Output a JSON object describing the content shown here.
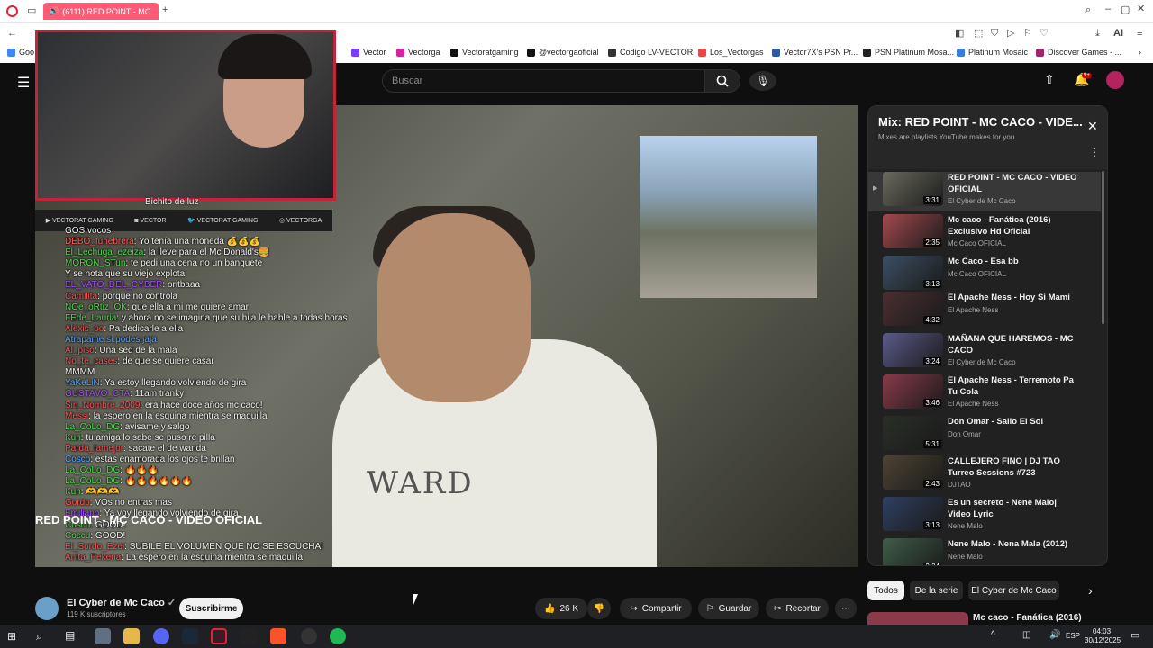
{
  "browser": {
    "tab_title": "(6111) RED POINT - MC",
    "bookmarks": [
      "Goo",
      "Vector",
      "Vectorga",
      "Vectoratgaming",
      "@vectorgaoficial",
      "Codigo LV-VECTOR",
      "Los_Vectorgas",
      "Vector7X's PSN Pr...",
      "PSN Platinum Mosa...",
      "Platinum Mosaic",
      "Discover Games - ..."
    ],
    "ai_label": "AI"
  },
  "youtube": {
    "search_placeholder": "Buscar",
    "notif_count": "9+",
    "video_title": "RED POINT - MC CACO - VIDEO OFICIAL",
    "channel_name": "El Cyber de Mc Caco",
    "subscribers": "119 K suscriptores",
    "subscribe_label": "Suscribirme",
    "likes": "26 K",
    "share_label": "Compartir",
    "save_label": "Guardar",
    "clip_label": "Recortar",
    "shirt_text": "WARD",
    "chips": [
      "Todos",
      "De la serie",
      "El Cyber de Mc Caco"
    ],
    "next_preview_title": "Mc caco - Fanática (2016)"
  },
  "stream_overlay": {
    "chat_top": "Bichito de luz",
    "social": [
      "VECTORAT GAMING",
      "VECTOR",
      "VECTORAT GAMING",
      "VECTORGA"
    ],
    "chat": [
      {
        "user": "",
        "msg": "GOS vocos",
        "color": "#f1f1f1"
      },
      {
        "user": "DEBO_funebrera",
        "msg": "Yo tenía una moneda 💰💰💰",
        "color": "#ff5b5b"
      },
      {
        "user": "El_Lechuga_ezeiza",
        "msg": "la lleve para el Mc Donald's🍔",
        "color": "#4ed94e"
      },
      {
        "user": "MORON_STun",
        "msg": "te pedi una cena no un banquete",
        "color": "#4ed94e"
      },
      {
        "user": "",
        "msg": "Y se nota que su viejo explota",
        "color": "#f1f1f1"
      },
      {
        "user": "EL_VATO_DEL_CYBER",
        "msg": "oritbaaa",
        "color": "#a64dff"
      },
      {
        "user": "Camilita",
        "msg": "porque no controla",
        "color": "#ff4f4f"
      },
      {
        "user": "NOe_oRtiz_OK",
        "msg": "que ella a mi me quiere amar",
        "color": "#4ed94e"
      },
      {
        "user": "FEde_Lauria",
        "msg": "y ahora no se imagina que su hija le hable a todas horas",
        "color": "#4ed94e"
      },
      {
        "user": "Alexis_oo",
        "msg": "Pa dedicarle a ella",
        "color": "#ff4f4f"
      },
      {
        "user": "Atrapame.si.podes.jaja",
        "msg": "",
        "color": "#55a6ff"
      },
      {
        "user": "Al_piso",
        "msg": "Una sed de la mala",
        "color": "#ff4f4f"
      },
      {
        "user": "No_te_cases",
        "msg": "de que se quiere casar",
        "color": "#ff4f4f"
      },
      {
        "user": "",
        "msg": "MMMM",
        "color": "#f1f1f1"
      },
      {
        "user": "YaKeLiN",
        "msg": "Ya estoy llegando volviendo de gira",
        "color": "#55a6ff"
      },
      {
        "user": "GUSTAVO_CTA",
        "msg": "11am tranky",
        "color": "#a64dff"
      },
      {
        "user": "Sin_Nombre_2009",
        "msg": "era hace doce años mc caco!",
        "color": "#ff4f4f"
      },
      {
        "user": "Messi",
        "msg": "la espero en la esquina mientra se maquilla",
        "color": "#ff4f4f"
      },
      {
        "user": "La_CoLo_DG",
        "msg": "avisame y salgo",
        "color": "#4ed94e"
      },
      {
        "user": "Kun",
        "msg": "tu amiga lo sabe se puso re pilla",
        "color": "#4ed94e"
      },
      {
        "user": "Parda_lamejor",
        "msg": "sacate el de wanda",
        "color": "#ff4f4f"
      },
      {
        "user": "Cosco",
        "msg": "estas enamorada los ojos te brillan",
        "color": "#55a6ff"
      },
      {
        "user": "La_CoLo_DG",
        "msg": "🔥🔥🔥",
        "color": "#4ed94e"
      },
      {
        "user": "La_CoLo_DG",
        "msg": "🔥🔥🔥🔥🔥🔥",
        "color": "#4ed94e"
      },
      {
        "user": "Kun",
        "msg": "🫶🫶🫶",
        "color": "#4ed94e"
      },
      {
        "user": "Gordo",
        "msg": "VOs no entras mas",
        "color": "#ff4f4f"
      },
      {
        "user": "Emiliano",
        "msg": "Ya voy llegando volviendo de gira",
        "color": "#a64dff"
      },
      {
        "user": "Coscu",
        "msg": "GOOD!",
        "color": "#4ed94e"
      },
      {
        "user": "Coscu",
        "msg": "GOOD!",
        "color": "#4ed94e"
      },
      {
        "user": "El_Sordo_Ezei",
        "msg": "SUBILE EL VOLUMEN QUE NO SE ESCUCHA!",
        "color": "#ff4f4f"
      },
      {
        "user": "Anita_Pekena",
        "msg": "La espero en la esquina mientra se maquilla",
        "color": "#ff4f4f"
      }
    ]
  },
  "mix": {
    "title": "Mix: RED POINT - MC CACO - VIDE...",
    "subtitle": "Mixes are playlists YouTube makes for you",
    "items": [
      {
        "title": "RED POINT - MC CACO - VIDEO OFICIAL",
        "channel": "El Cyber de Mc Caco",
        "duration": "3:31",
        "thumb": "#6b6b60"
      },
      {
        "title": "Mc caco - Fanática (2016) Exclusivo Hd Oficial",
        "channel": "Mc Caco OFICIAL",
        "duration": "2:35",
        "thumb": "#a44a4f"
      },
      {
        "title": "Mc Caco - Esa bb",
        "channel": "Mc Caco OFICIAL",
        "duration": "3:13",
        "thumb": "#3c4e63"
      },
      {
        "title": "El Apache Ness - Hoy Si Mami",
        "channel": "El Apache Ness",
        "duration": "4:32",
        "thumb": "#4a2f33"
      },
      {
        "title": "MAÑANA QUE HAREMOS - MC CACO",
        "channel": "El Cyber de Mc Caco",
        "duration": "3:24",
        "thumb": "#5c5a8a"
      },
      {
        "title": "El Apache Ness - Terremoto Pa Tu Cola",
        "channel": "El Apache Ness",
        "duration": "3:46",
        "thumb": "#8a3a4a"
      },
      {
        "title": "Don Omar - Salio El Sol",
        "channel": "Don Omar",
        "duration": "5:31",
        "thumb": "#2a2f28"
      },
      {
        "title": "CALLEJERO FINO | DJ TAO Turreo Sessions #723",
        "channel": "DJTAO",
        "duration": "2:43",
        "thumb": "#4d4433"
      },
      {
        "title": "Es un secreto - Nene Malo| Video Lyric",
        "channel": "Nene Malo",
        "duration": "3:13",
        "thumb": "#2f4060"
      },
      {
        "title": "Nene Malo - Nena Mala (2012)",
        "channel": "Nene Malo",
        "duration": "2:24",
        "thumb": "#3f5d4a"
      }
    ]
  },
  "taskbar": {
    "time": "04:03",
    "date": "30/12/2025",
    "lang": "ESP"
  }
}
